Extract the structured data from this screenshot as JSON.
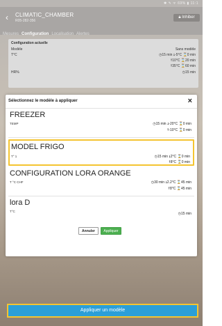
{
  "statusbar": {
    "text": "✱ ✎ ᯤ 69% ▮ 11:1"
  },
  "appbar": {
    "back_icon": "chevron-left-icon",
    "title": "CLIMATIC_CHAMBER",
    "subtitle": "R05-282-356",
    "inhib_label": "Inhiber"
  },
  "tabs": [
    "Mesures",
    "Configuration",
    "Localisation",
    "Alertes"
  ],
  "config": {
    "title": "Configuration actuelle",
    "model_label": "Modèle",
    "model_value": "Sans modèle",
    "temp_label": "T°C",
    "temp_line1": "◷15 min ⭣-5°C ⌛0 min",
    "temp_line2": "⭡10°C ⌛20 min",
    "temp_line3": "⭡35°C ⌛60 min",
    "hr_label": "HR%",
    "hr_line": "◷15 min"
  },
  "modal": {
    "title": "Sélectionnez le modèle à appliquer",
    "close_icon": "close-icon",
    "models": [
      {
        "name": "FREEZER",
        "unit": "TEMP",
        "line1": "◷15 min ⭣-20°C ⌛0 min",
        "line2": "⭡-10°C ⌛0 min"
      },
      {
        "name": "MODEL FRIGO",
        "unit": "T° 1",
        "line1": "◷15 min ⭣2°C ⌛0 min",
        "line2": "⭡8°C ⌛0 min"
      },
      {
        "name": "CONFIGURATION LORA ORANGE",
        "unit": "T °C CHF",
        "line1": "◷30 min ⭣2.2°C ⌛45 min",
        "line2": "⭡8°C ⌛45 min"
      },
      {
        "name": "lora D",
        "unit": "T°C",
        "line1": "◷15 min",
        "line2": ""
      }
    ],
    "cancel_label": "Annuler",
    "apply_label": "Appliquer"
  },
  "footer": {
    "apply_model_label": "Appliquer un modèle"
  },
  "colors": {
    "highlight": "#f4c430",
    "primary": "#2b9fd8",
    "success": "#4caf50"
  }
}
